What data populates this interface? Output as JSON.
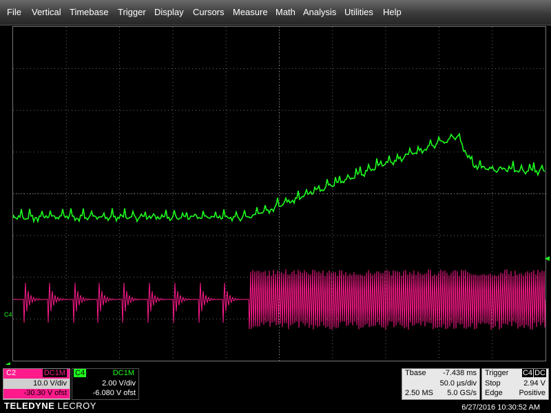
{
  "menu": [
    "File",
    "Vertical",
    "Timebase",
    "Trigger",
    "Display",
    "Cursors",
    "Measure",
    "Math",
    "Analysis",
    "Utilities",
    "Help"
  ],
  "colors": {
    "c2": "#ff1a8c",
    "c4": "#1eff1e",
    "grid": "#6e6e6e"
  },
  "screen": {
    "trigger_level_marker_icon": "triangle-left-icon",
    "c4_label": "C4"
  },
  "ch2": {
    "name": "C2",
    "coupling": "DC1M",
    "vdiv": "10.0 V/div",
    "offset": "-30.30 V ofst"
  },
  "ch4": {
    "name": "C4",
    "coupling": "DC1M",
    "vdiv": "2.00 V/div",
    "offset": "-6.080 V ofst"
  },
  "timebase": {
    "label": "Tbase",
    "delay": "-7.438 ms",
    "per_div": "50.0 µs/div",
    "samples": "2.50 MS",
    "rate": "5.0 GS/s"
  },
  "trigger": {
    "label": "Trigger",
    "source": "C4",
    "coupling": "DC",
    "mode": "Stop",
    "level": "2.94 V",
    "type": "Edge",
    "slope": "Positive"
  },
  "brand": {
    "bold": "TELEDYNE",
    "thin": "LECROY"
  },
  "datetime": "6/27/2016 10:30:52 AM"
}
